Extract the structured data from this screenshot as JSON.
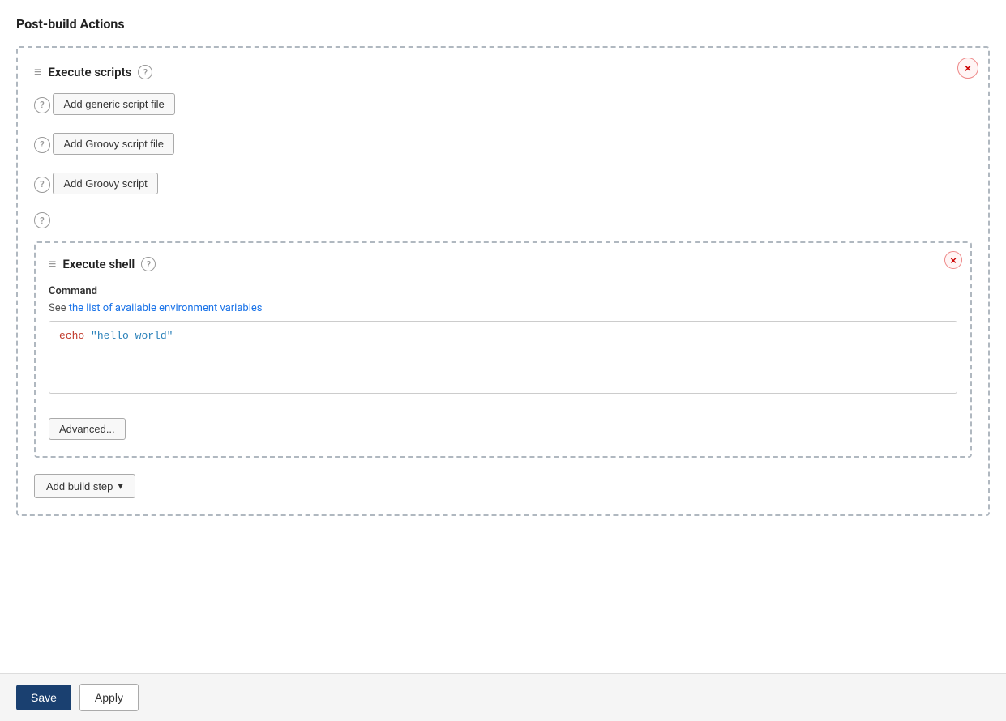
{
  "page": {
    "title": "Post-build Actions"
  },
  "outer_section": {
    "title": "Execute scripts",
    "close_label": "×",
    "drag_handle": "≡"
  },
  "script_rows": [
    {
      "id": "generic-script-file",
      "question": "?",
      "button_label": "Add generic script file"
    },
    {
      "id": "groovy-script-file",
      "question": "?",
      "button_label": "Add Groovy script file"
    },
    {
      "id": "groovy-script",
      "question": "?",
      "button_label": "Add Groovy script"
    }
  ],
  "inner_section": {
    "drag_handle": "≡",
    "title": "Execute shell",
    "close_outer_label": "×",
    "close_inner_label": "×",
    "question": "?",
    "command_label": "Command",
    "env_vars_prefix": "See ",
    "env_vars_link_text": "the list of available environment variables",
    "code_content": "echo \"hello world\"",
    "advanced_btn_label": "Advanced..."
  },
  "question_badge_4": "?",
  "add_build_step": {
    "label": "Add build step",
    "chevron": "▾"
  },
  "footer": {
    "save_label": "Save",
    "apply_label": "Apply"
  }
}
